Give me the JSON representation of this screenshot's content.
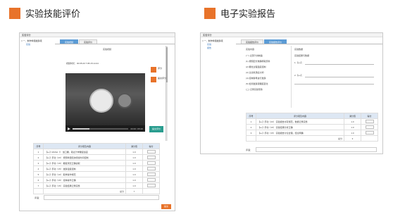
{
  "left_section": {
    "title": "实验技能评价"
  },
  "right_section": {
    "title": "电子实验报告"
  },
  "left_app": {
    "window_title": "实验评分",
    "tree": {
      "root": "□ 一、制作啤酒发酵液",
      "children": [
        "实验"
      ]
    },
    "tabs": [
      "实验视频",
      "实验评价"
    ],
    "video_caption": "实验视频",
    "video_meta": "视频时长：00:05:20  7:05:15:14:24",
    "video_time": "00:00 / 05:20",
    "video_progress": 0.3,
    "side_items": [
      "评分",
      "提交评分"
    ],
    "side_button": "提交评价",
    "table": {
      "headers": [
        "序号",
        "评分项及内容",
        "满分值",
        "得分"
      ],
      "rows": [
        [
          "1",
          "【e+】MASH（） 加口糖，取麦汁样糖度适宜",
          "1.0",
          ""
        ],
        [
          "2",
          "【e+】手动（20） 按照啤酒泡沫持续时间控制",
          "1.0",
          ""
        ],
        [
          "3",
          "【e+】手动（15） 糖度测定正确读取",
          "1.0",
          ""
        ],
        [
          "4",
          "【e+】手动（15） 发酵温度控制",
          "1.0",
          ""
        ],
        [
          "5",
          "【e+】手动（10） 取样操作规范",
          "1.0",
          ""
        ],
        [
          "6",
          "【e+】手动（15） 接种操作正确",
          "1.0",
          ""
        ],
        [
          "7",
          "【e+】手动（15） 实验结果记录完整",
          "1.0",
          ""
        ]
      ],
      "total_label": "总分",
      "total_value": "7"
    },
    "comment_label": "评语：",
    "submit_label": "提交"
  },
  "right_app": {
    "window_title": "实验评分",
    "tree": {
      "root": "□ 一、制作啤酒发酵液",
      "children": [
        "实验",
        "报告"
      ]
    },
    "tabs": [
      "实验报告评价",
      "实验报告评价"
    ],
    "left_heading": "实验内容",
    "left_lines": [
      "(一) 麦芽汁的制备",
      "(1) 按照配方准确称取原料",
      "(2) 糖化过程温度控制",
      "(3) 过滤煮沸后冷却",
      "(4) 接种酵母进行发酵",
      "(5) 检测发酵液糖度变化",
      "(二) 记录实验现象"
    ],
    "right_heading": "实验数据",
    "right_lines": [
      "实验结果与数据",
      "1.【e+】：",
      "2.【e+】："
    ],
    "table": {
      "headers": [
        "序号",
        "评分项及内容",
        "满分值",
        "得分"
      ],
      "rows": [
        [
          "1",
          "【e+】手动（20） 实验报告书写规范，数据记录完整",
          "1.0",
          ""
        ],
        [
          "2",
          "【e+】手动（15） 实验结果分析正确",
          "1.0",
          ""
        ],
        [
          "3",
          "【e+】手动（15） 实验报告讨论合理，结论明确",
          "1.0",
          ""
        ]
      ],
      "total_label": "总分",
      "total_value": "3"
    },
    "comment_label": "评语："
  },
  "colors": {
    "accent": "#e8732a",
    "tab_active": "#5b9bd5",
    "green": "#2a9d8f"
  }
}
